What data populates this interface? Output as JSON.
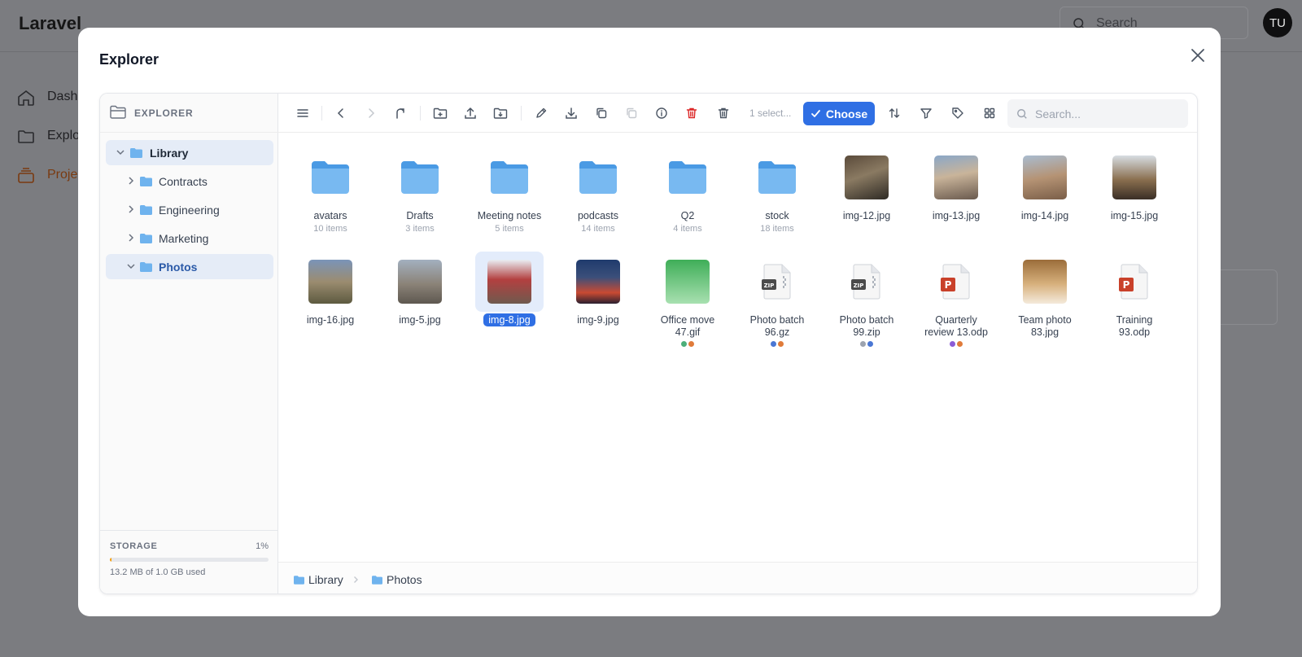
{
  "background": {
    "logo": "Laravel",
    "search_placeholder": "Search",
    "avatar_initials": "TU",
    "nav": [
      "Dash",
      "Explo",
      "Proje"
    ]
  },
  "modal": {
    "title": "Explorer"
  },
  "sidebar": {
    "header": "EXPLORER",
    "tree": [
      {
        "label": "Library",
        "expanded": true,
        "selected": true
      },
      {
        "label": "Contracts",
        "expanded": false
      },
      {
        "label": "Engineering",
        "expanded": false
      },
      {
        "label": "Marketing",
        "expanded": false
      },
      {
        "label": "Photos",
        "expanded": true,
        "selected": true
      }
    ],
    "storage": {
      "label": "STORAGE",
      "percent_text": "1%",
      "percent": 1,
      "used_text": "13.2 MB of 1.0 GB used"
    }
  },
  "toolbar": {
    "selection_count": "1 select...",
    "choose_label": "Choose",
    "search_placeholder": "Search..."
  },
  "items": [
    {
      "name": "avatars",
      "sub": "10 items",
      "kind": "folder"
    },
    {
      "name": "Drafts",
      "sub": "3 items",
      "kind": "folder"
    },
    {
      "name": "Meeting notes",
      "sub": "5 items",
      "kind": "folder"
    },
    {
      "name": "podcasts",
      "sub": "14 items",
      "kind": "folder"
    },
    {
      "name": "Q2",
      "sub": "4 items",
      "kind": "folder"
    },
    {
      "name": "stock",
      "sub": "18 items",
      "kind": "folder"
    },
    {
      "name": "img-12.jpg",
      "kind": "image"
    },
    {
      "name": "img-13.jpg",
      "kind": "image"
    },
    {
      "name": "img-14.jpg",
      "kind": "image"
    },
    {
      "name": "img-15.jpg",
      "kind": "image"
    },
    {
      "name": "img-16.jpg",
      "kind": "image"
    },
    {
      "name": "img-5.jpg",
      "kind": "image"
    },
    {
      "name": "img-8.jpg",
      "kind": "image",
      "selected": true
    },
    {
      "name": "img-9.jpg",
      "kind": "image"
    },
    {
      "name": "Office move 47.gif",
      "name_lines": [
        "Office move",
        "47.gif"
      ],
      "kind": "gif",
      "tags": [
        "#4caf7a",
        "#e07b3a"
      ]
    },
    {
      "name": "Photo batch 96.gz",
      "name_lines": [
        "Photo batch",
        "96.gz"
      ],
      "kind": "zip",
      "tags": [
        "#4a77d4",
        "#e07b3a"
      ]
    },
    {
      "name": "Photo batch 99.zip",
      "name_lines": [
        "Photo batch",
        "99.zip"
      ],
      "kind": "zip",
      "tags": [
        "#9ca3af",
        "#4a77d4"
      ]
    },
    {
      "name": "Quarterly review 13.odp",
      "name_lines": [
        "Quarterly",
        "review 13.odp"
      ],
      "kind": "ppt",
      "tags": [
        "#8b5cd6",
        "#e07b3a"
      ]
    },
    {
      "name": "Team photo 83.jpg",
      "name_lines": [
        "Team photo",
        "83.jpg"
      ],
      "kind": "gradient"
    },
    {
      "name": "Training 93.odp",
      "name_lines": [
        "Training",
        "93.odp"
      ],
      "kind": "ppt"
    }
  ],
  "breadcrumb": [
    "Library",
    "Photos"
  ],
  "colors": {
    "accent": "#2f6fe4",
    "folder": "#6fb3ee",
    "danger": "#dc2626",
    "storage_fill": "#f59e0b"
  }
}
